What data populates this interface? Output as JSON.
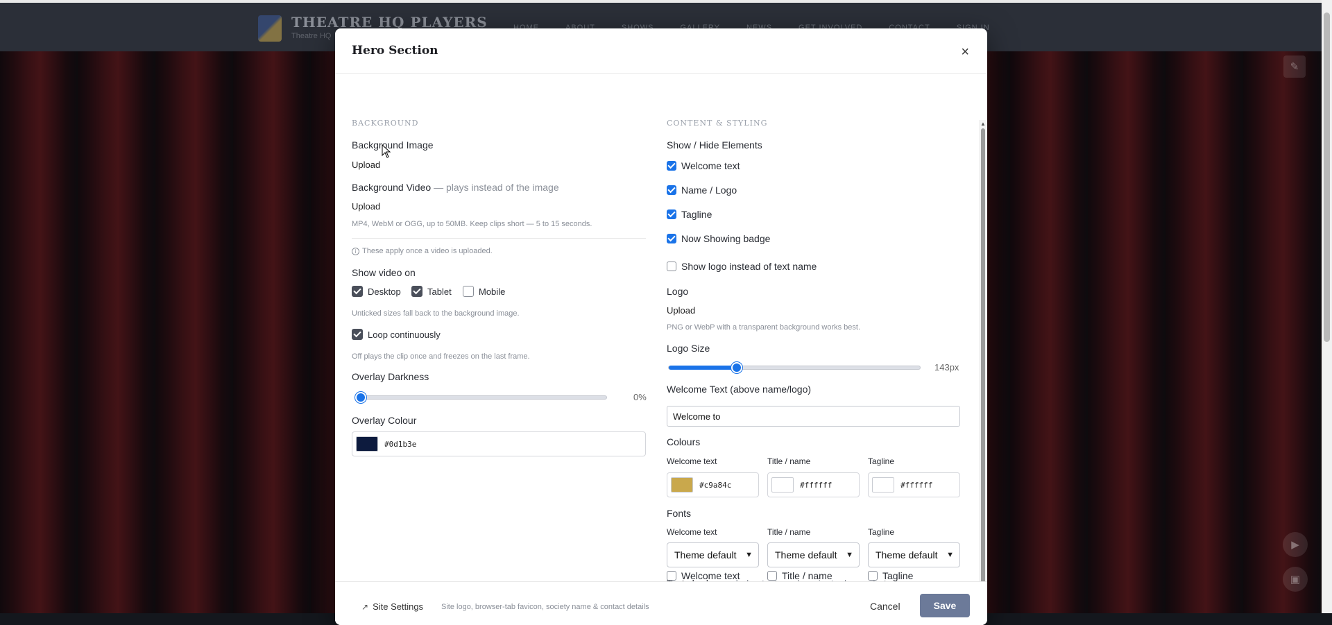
{
  "site": {
    "title": "THEATRE HQ PLAYERS",
    "subtitle": "Theatre HQ",
    "nav": [
      "HOME",
      "ABOUT",
      "SHOWS",
      "GALLERY",
      "NEWS",
      "GET INVOLVED",
      "CONTACT",
      "SIGN IN"
    ]
  },
  "modal": {
    "title": "Hero Section",
    "close": "×"
  },
  "background": {
    "section_title": "BACKGROUND",
    "image_label": "Background Image",
    "image_upload": "Upload",
    "video_label": "Background Video",
    "video_note": "— plays instead of the image",
    "video_upload": "Upload",
    "video_hint": "MP4, WebM or OGG, up to 50MB. Keep clips short — 5 to 15 seconds.",
    "apply_note": "These apply once a video is uploaded.",
    "show_video_on": "Show video on",
    "devices": [
      {
        "label": "Desktop",
        "checked": true
      },
      {
        "label": "Tablet",
        "checked": true
      },
      {
        "label": "Mobile",
        "checked": false
      }
    ],
    "untick_hint": "Unticked sizes fall back to the background image.",
    "loop_label": "Loop continuously",
    "loop_checked": true,
    "loop_hint": "Off plays the clip once and freezes on the last frame.",
    "overlay_darkness_label": "Overlay Darkness",
    "overlay_darkness_value": "0%",
    "overlay_darkness_level": 0,
    "overlay_colour_label": "Overlay Colour",
    "overlay_colour": "#0d1b3e"
  },
  "content": {
    "section_title": "CONTENT & STYLING",
    "show_hide_label": "Show / Hide Elements",
    "elements": [
      {
        "label": "Welcome text",
        "checked": true
      },
      {
        "label": "Name / Logo",
        "checked": true
      },
      {
        "label": "Tagline",
        "checked": true
      },
      {
        "label": "Now Showing badge",
        "checked": true
      }
    ],
    "show_logo_label": "Show logo instead of text name",
    "show_logo_checked": false,
    "logo_label": "Logo",
    "logo_upload": "Upload",
    "logo_hint": "PNG or WebP with a transparent background works best.",
    "logo_size_label": "Logo Size",
    "logo_size_value": "143px",
    "logo_size_level": 0.26,
    "welcome_text_label": "Welcome Text (above name/logo)",
    "welcome_text_value": "Welcome to",
    "colours_label": "Colours",
    "colours": [
      {
        "label": "Welcome text",
        "hex": "#c9a84c"
      },
      {
        "label": "Title / name",
        "hex": "#ffffff"
      },
      {
        "label": "Tagline",
        "hex": "#ffffff"
      }
    ],
    "fonts_label": "Fonts",
    "fonts": [
      {
        "label": "Welcome text",
        "value": "Theme default"
      },
      {
        "label": "Title / name",
        "value": "Theme default"
      },
      {
        "label": "Tagline",
        "value": "Theme default"
      }
    ],
    "text_shadow_label": "Text shadow",
    "text_shadow_note": "— helps text read against a busy photo",
    "shadows": [
      {
        "label": "Welcome text",
        "checked": false
      },
      {
        "label": "Title / name",
        "checked": false
      },
      {
        "label": "Tagline",
        "checked": false
      }
    ]
  },
  "footer": {
    "site_settings": "Site Settings",
    "site_settings_hint": "Site logo, browser-tab favicon, society name & contact details",
    "cancel": "Cancel",
    "save": "Save"
  }
}
